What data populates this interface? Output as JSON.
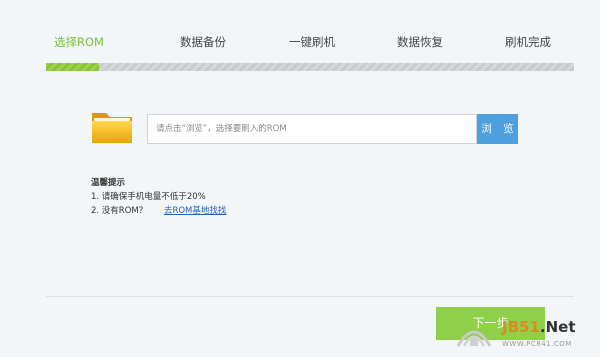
{
  "steps": {
    "items": [
      {
        "label": "选择ROM",
        "active": true
      },
      {
        "label": "数据备份",
        "active": false
      },
      {
        "label": "一键刷机",
        "active": false
      },
      {
        "label": "数据恢复",
        "active": false
      },
      {
        "label": "刷机完成",
        "active": false
      }
    ],
    "progress": 0.1
  },
  "rom_select": {
    "placeholder": "请点击“浏览”，选择要刷入的ROM",
    "browse_label": "浏 览",
    "folder_icon": "folder-icon"
  },
  "tips": {
    "title": "温馨提示",
    "line1": "1. 请确保手机电量不低于20%",
    "line2": "2. 没有ROM？",
    "link": "去ROM基地找找"
  },
  "footer": {
    "next_label": "下一步"
  },
  "watermark": {
    "text_a": "JB51",
    "text_b": ".Net",
    "subtext": "WWW.PC841.COM"
  },
  "colors": {
    "accent_green": "#8fcf4a",
    "active_step": "#7bbf3a",
    "browse_blue": "#4d9fde",
    "link_blue": "#2266aa"
  }
}
